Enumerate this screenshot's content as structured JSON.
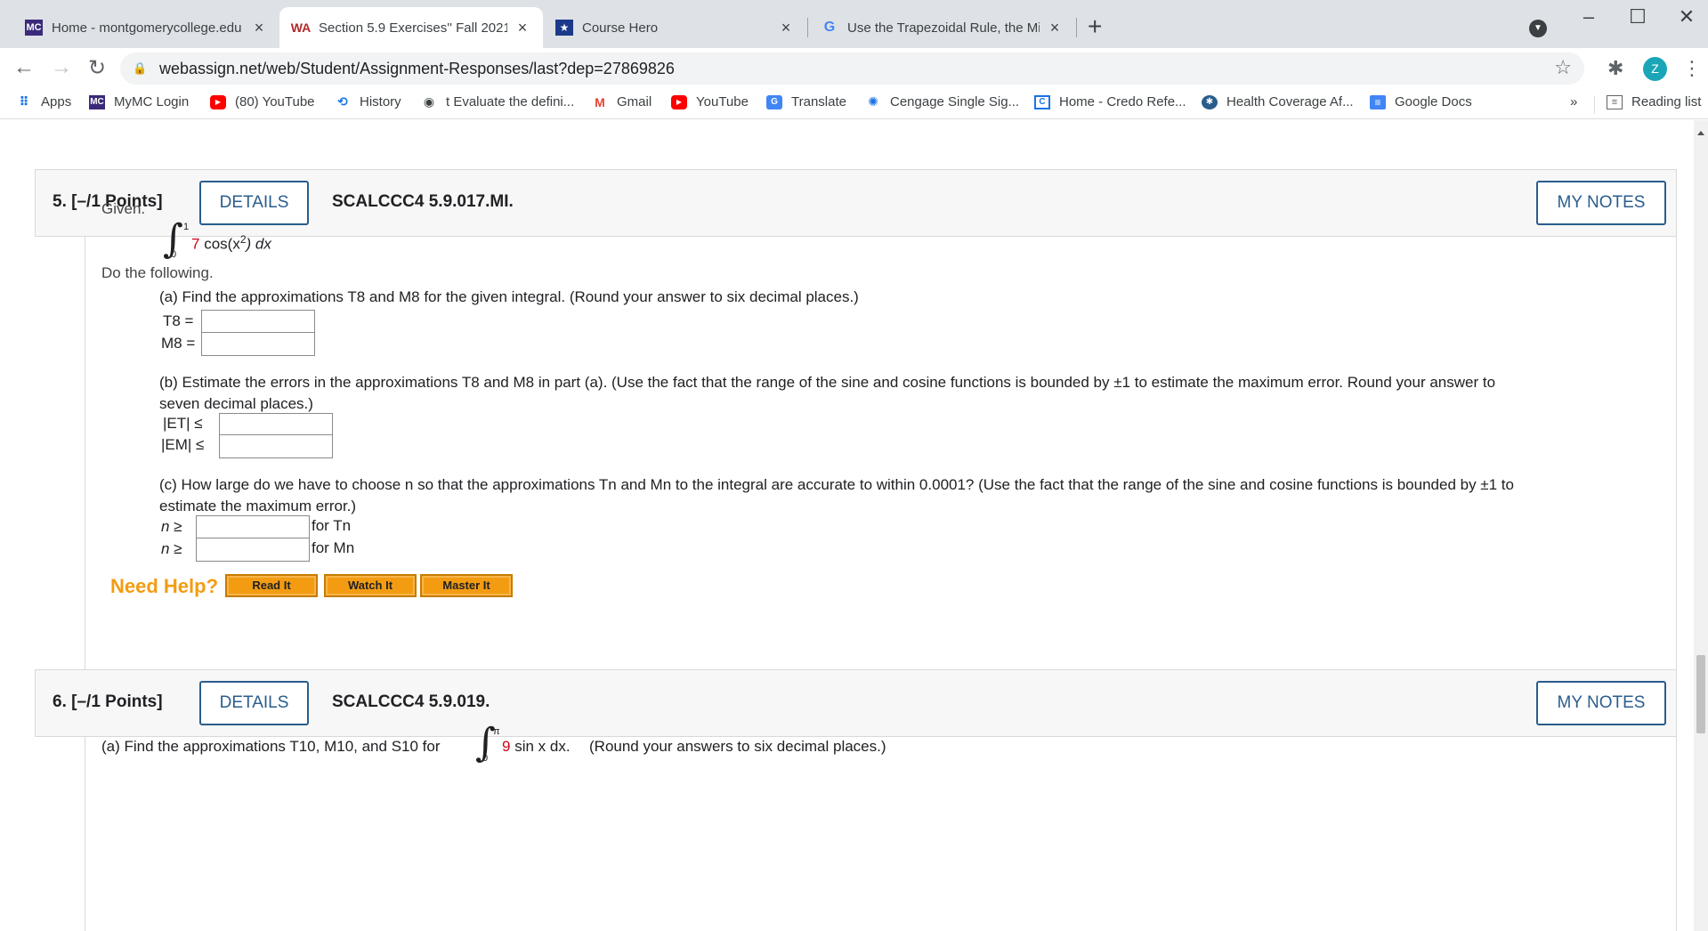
{
  "browser": {
    "tabs": [
      {
        "title": "Home - montgomerycollege.edu",
        "icon": "mc-logo-icon"
      },
      {
        "title": "Section 5.9 Exercises'' Fall 2021 -",
        "icon": "webassign-icon"
      },
      {
        "title": "Course Hero",
        "icon": "course-hero-icon"
      },
      {
        "title": "Use the Trapezoidal Rule, the Mic",
        "icon": "google-icon"
      }
    ],
    "url": "webassign.net/web/Student/Assignment-Responses/last?dep=27869826",
    "profile_initial": "Z",
    "bookmarks": [
      {
        "label": "Apps"
      },
      {
        "label": "MyMC Login"
      },
      {
        "label": "(80) YouTube"
      },
      {
        "label": "History"
      },
      {
        "label": "t Evaluate the defini..."
      },
      {
        "label": "Gmail"
      },
      {
        "label": "YouTube"
      },
      {
        "label": "Translate"
      },
      {
        "label": "Cengage Single Sig..."
      },
      {
        "label": "Home - Credo Refe..."
      },
      {
        "label": "Health Coverage Af..."
      },
      {
        "label": "Google Docs"
      }
    ],
    "bookmarks_overflow": "»",
    "reading_list": "Reading list"
  },
  "q5": {
    "number": "5.",
    "points": "[–/1 Points]",
    "details": "DETAILS",
    "code": "SCALCCC4 5.9.017.MI.",
    "my_notes": "MY NOTES",
    "given": "Given.",
    "integral_upper": "1",
    "integral_lower": "0",
    "integrand_coef": "7",
    "integrand_text": "cos(x",
    "integrand_exp": "2",
    "integrand_end": ") dx",
    "do_following": "Do the following.",
    "part_a": "(a) Find the approximations T8 and M8 for the given integral. (Round your answer to six decimal places.)",
    "label_T8": "T8 =",
    "label_M8": "M8 =",
    "part_b_line1": "(b) Estimate the errors in the approximations T8 and M8 in part (a). (Use the fact that the range of the sine and cosine functions is bounded by ±1 to estimate the maximum error. Round your answer to",
    "part_b_line2": "seven decimal places.)",
    "label_ET": "|ET| ≤",
    "label_EM": "|EM| ≤",
    "part_c_line1": "(c) How large do we have to choose n so that the approximations Tn and Mn to the integral are accurate to within 0.0001? (Use the fact that the range of the sine and cosine functions is bounded by ±1 to",
    "part_c_line2": "estimate the maximum error.)",
    "label_n": "n ≥",
    "for_Tn": "for Tn",
    "for_Mn": "for Mn",
    "need_help": "Need Help?",
    "read_it": "Read It",
    "watch_it": "Watch It",
    "master_it": "Master It"
  },
  "q6": {
    "number": "6.",
    "points": "[–/1 Points]",
    "details": "DETAILS",
    "code": "SCALCCC4 5.9.019.",
    "my_notes": "MY NOTES",
    "part_a_pre": "(a) Find the approximations T10, M10, and S10 for",
    "integral_upper": "π",
    "integral_lower": "0",
    "integrand_coef": "9",
    "integrand_text": "sin x dx.",
    "part_a_post": "(Round your answers to six decimal places.)"
  }
}
